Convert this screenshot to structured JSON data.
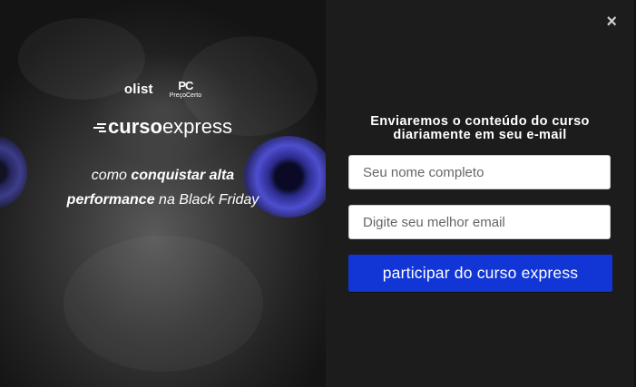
{
  "colors": {
    "background": "#1c1c1c",
    "button": "#1236d6",
    "eye_accent": "#4e4ed0",
    "text": "#ffffff"
  },
  "brand": {
    "olist": "olist",
    "precocerto_mark": "PC",
    "precocerto_name": "PreçoCerto",
    "curso_bold": "curso",
    "curso_light": "express"
  },
  "tagline": {
    "part1": "como ",
    "part2_bold": "conquistar alta",
    "part3_bold": "performance",
    "part4": " na Black Friday"
  },
  "form": {
    "headline_line1": "Enviaremos o conteúdo do curso",
    "headline_line2": "diariamente em seu e-mail",
    "name_placeholder": "Seu nome completo",
    "email_placeholder": "Digite seu melhor email",
    "submit_label": "participar do curso express"
  },
  "close_icon": "×",
  "icons": [
    "close-icon",
    "curso-lines-icon",
    "owl-image"
  ]
}
